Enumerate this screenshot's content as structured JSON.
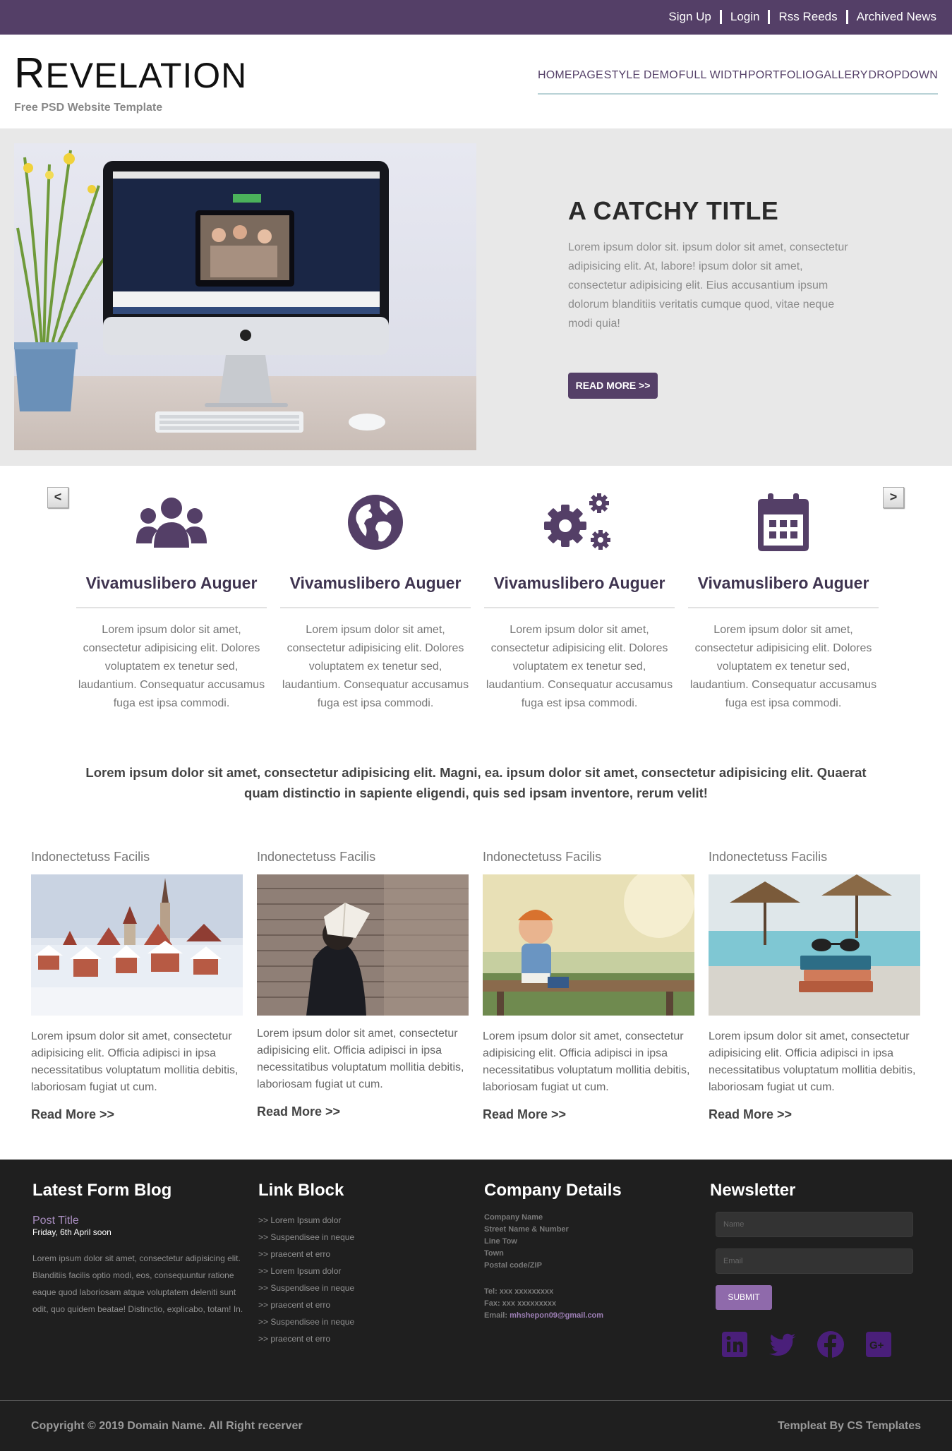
{
  "topbar": {
    "links": [
      "Sign Up",
      "Login",
      "Rss Reeds",
      "Archived News"
    ]
  },
  "header": {
    "logo_first": "R",
    "logo_rest": "EVELATION",
    "tagline": "Free PSD Website Template",
    "nav": [
      "HOMEPAGE",
      "STYLE DEMO",
      "FULL WIDTH",
      "PORTFOLIO",
      "GALLERY",
      "DROPDOWN"
    ]
  },
  "hero": {
    "title": "A CATCHY TITLE",
    "text": "Lorem ipsum dolor sit. ipsum dolor sit amet, consectetur adipisicing elit. At, labore! ipsum dolor sit amet, consectetur adipisicing elit. Eius accusantium ipsum dolorum blanditiis veritatis cumque quod, vitae neque modi quia!",
    "button": "READ MORE >>"
  },
  "slider": {
    "prev": "<",
    "next": ">"
  },
  "features": [
    {
      "icon": "users-icon",
      "title": "Vivamuslibero Auguer",
      "text": "Lorem ipsum dolor sit amet, consectetur adipisicing elit. Dolores voluptatem ex tenetur sed, laudantium. Consequatur accusamus fuga est ipsa commodi."
    },
    {
      "icon": "globe-icon",
      "title": "Vivamuslibero Auguer",
      "text": "Lorem ipsum dolor sit amet, consectetur adipisicing elit. Dolores voluptatem ex tenetur sed, laudantium. Consequatur accusamus fuga est ipsa commodi."
    },
    {
      "icon": "gears-icon",
      "title": "Vivamuslibero Auguer",
      "text": "Lorem ipsum dolor sit amet, consectetur adipisicing elit. Dolores voluptatem ex tenetur sed, laudantium. Consequatur accusamus fuga est ipsa commodi."
    },
    {
      "icon": "calendar-icon",
      "title": "Vivamuslibero Auguer",
      "text": "Lorem ipsum dolor sit amet, consectetur adipisicing elit. Dolores voluptatem ex tenetur sed, laudantium. Consequatur accusamus fuga est ipsa commodi."
    }
  ],
  "statement": "Lorem ipsum dolor sit amet, consectetur adipisicing elit. Magni, ea. ipsum dolor sit amet, consectetur adipisicing elit. Quaerat quam distinctio in sapiente eligendi, quis sed ipsam inventore, rerum velit!",
  "posts": [
    {
      "title": "Indonectetuss Facilis",
      "image": "winter-town-image",
      "text": "Lorem ipsum dolor sit amet, consectetur adipisicing elit. Officia adipisci in ipsa necessitatibus voluptatum mollitia debitis, laboriosam fugiat ut cum.",
      "more": "Read More >>"
    },
    {
      "title": "Indonectetuss Facilis",
      "image": "reading-girl-image",
      "text": "Lorem ipsum dolor sit amet, consectetur adipisicing elit. Officia adipisci in ipsa necessitatibus voluptatum mollitia debitis, laboriosam fugiat ut cum.",
      "more": "Read More >>"
    },
    {
      "title": "Indonectetuss Facilis",
      "image": "laughing-boy-image",
      "text": "Lorem ipsum dolor sit amet, consectetur adipisicing elit. Officia adipisci in ipsa necessitatibus voluptatum mollitia debitis, laboriosam fugiat ut cum.",
      "more": "Read More >>"
    },
    {
      "title": "Indonectetuss Facilis",
      "image": "beach-books-image",
      "text": "Lorem ipsum dolor sit amet, consectetur adipisicing elit. Officia adipisci in ipsa necessitatibus voluptatum mollitia debitis, laboriosam fugiat ut cum.",
      "more": "Read More >>"
    }
  ],
  "footer": {
    "blog": {
      "heading": "Latest Form Blog",
      "post_title": "Post Title",
      "date": "Friday, 6th April soon",
      "text": "Lorem ipsum dolor sit amet, consectetur adipisicing elit. Blanditiis facilis optio modi, eos, consequuntur ratione eaque quod laboriosam atque voluptatem deleniti sunt odit, quo quidem beatae! Distinctio, explicabo, totam! In."
    },
    "links": {
      "heading": "Link Block",
      "items": [
        ">> Lorem Ipsum dolor",
        ">> Suspendisee in neque",
        ">> praecent et erro",
        ">> Lorem Ipsum dolor",
        ">> Suspendisee in neque",
        ">> praecent et erro",
        ">> Suspendisee in neque",
        ">> praecent et erro"
      ]
    },
    "company": {
      "heading": "Company Details",
      "lines": [
        "Company Name",
        "Street Name & Number",
        "Line Tow",
        "Town",
        "Postal code/ZIP"
      ],
      "tel": "Tel: xxx xxxxxxxxx",
      "fax": "Fax: xxx xxxxxxxxx",
      "email_label": "Email:",
      "email": "mhshepon09@gmail.com"
    },
    "newsletter": {
      "heading": "Newsletter",
      "name_placeholder": "Name",
      "email_placeholder": "Email",
      "submit": "SUBMIT",
      "social": [
        "linkedin-icon",
        "twitter-icon",
        "facebook-icon",
        "google-plus-icon"
      ]
    }
  },
  "copyright": {
    "left": "Copyright © 2019 Domain Name. All Right recerver",
    "right": "Templeat By CS Templates"
  },
  "colors": {
    "brand": "#543f67",
    "accent": "#8f6aab",
    "social": "#4a1f7a",
    "footer_bg": "#1f1f1f"
  }
}
